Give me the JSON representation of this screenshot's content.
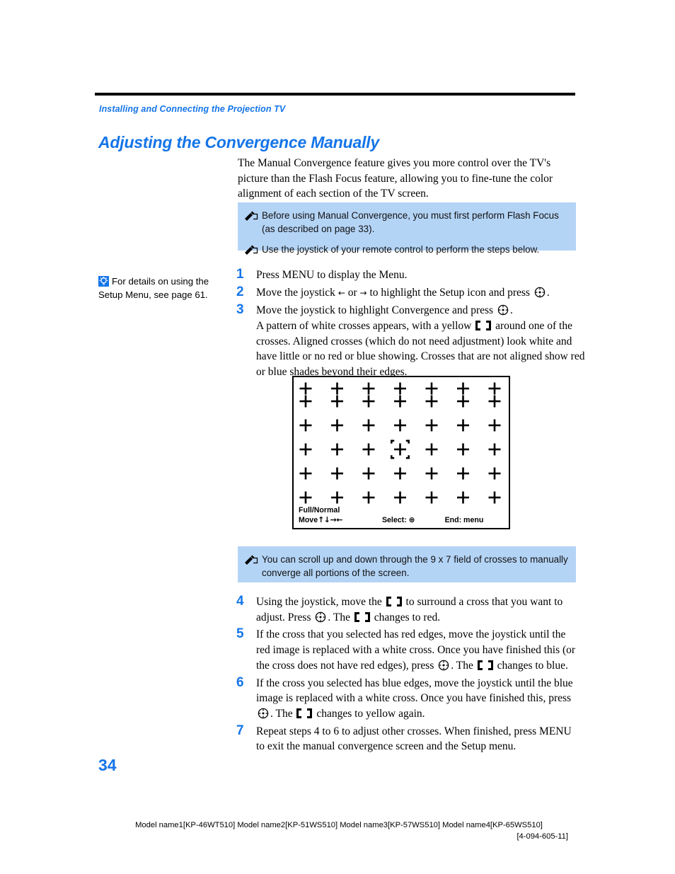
{
  "header": {
    "running_head": "Installing and Connecting the Projection TV",
    "title": "Adjusting the Convergence Manually"
  },
  "intro": {
    "paragraph": "The Manual Convergence feature gives you more control over the TV's picture than the Flash Focus feature, allowing you to fine-tune the color alignment of each section of the TV screen."
  },
  "notebox1": {
    "icon": "pencil-note-icon",
    "notes": [
      "Before using Manual Convergence, you must first perform Flash Focus (as described on page 33).",
      "Use the joystick of your remote control to perform the steps below."
    ]
  },
  "notebox2": {
    "icon": "pencil-note-icon",
    "notes": [
      "You can scroll up and down through the 9 x 7 field of crosses to manually converge all portions of the screen."
    ]
  },
  "margin_tip": {
    "icon": "lightbulb-tip-icon",
    "text": "For details on using the Setup Menu, see page 61."
  },
  "steps_a": [
    {
      "number": "1",
      "segments": [
        {
          "type": "text",
          "value": "Press MENU to display the Menu."
        }
      ]
    },
    {
      "number": "2",
      "segments": [
        {
          "type": "text",
          "value": "Move the joystick "
        },
        {
          "type": "glyph",
          "value": "←"
        },
        {
          "type": "text",
          "value": " or "
        },
        {
          "type": "glyph",
          "value": "→"
        },
        {
          "type": "text",
          "value": " to highlight the Setup icon and press "
        },
        {
          "type": "icon",
          "value": "joystick-button-icon"
        },
        {
          "type": "text",
          "value": "."
        }
      ]
    },
    {
      "number": "3",
      "segments": [
        {
          "type": "text",
          "value": "Move the joystick to highlight Convergence and press "
        },
        {
          "type": "icon",
          "value": "joystick-button-icon"
        },
        {
          "type": "text",
          "value": "."
        }
      ]
    }
  ],
  "step3_detail": [
    {
      "type": "text",
      "value": "A pattern of white crosses appears, with a yellow "
    },
    {
      "type": "icon",
      "value": "bracket-cursor-icon"
    },
    {
      "type": "text",
      "value": " around one of the crosses. Aligned crosses (which do not need adjustment) look white and have little or no red or blue showing. Crosses that are not aligned show red or blue shades beyond their edges."
    }
  ],
  "steps_b": [
    {
      "number": "4",
      "segments": [
        {
          "type": "text",
          "value": "Using the joystick, move the "
        },
        {
          "type": "icon",
          "value": "bracket-cursor-icon"
        },
        {
          "type": "text",
          "value": " to surround a cross that you want to adjust. Press "
        },
        {
          "type": "icon",
          "value": "joystick-button-icon"
        },
        {
          "type": "text",
          "value": ". The "
        },
        {
          "type": "icon",
          "value": "bracket-cursor-icon"
        },
        {
          "type": "text",
          "value": " changes to red."
        }
      ]
    },
    {
      "number": "5",
      "segments": [
        {
          "type": "text",
          "value": "If the cross that you selected has red edges, move the joystick until the red image is replaced with a white cross. Once you have finished this (or the cross does not have red edges), press "
        },
        {
          "type": "icon",
          "value": "joystick-button-icon"
        },
        {
          "type": "text",
          "value": ". The "
        },
        {
          "type": "icon",
          "value": "bracket-cursor-icon"
        },
        {
          "type": "text",
          "value": " changes to blue."
        }
      ]
    },
    {
      "number": "6",
      "segments": [
        {
          "type": "text",
          "value": "If the cross you selected has blue edges, move the joystick until the blue image is replaced with a white cross. Once you have finished this, press "
        },
        {
          "type": "icon",
          "value": "joystick-button-icon"
        },
        {
          "type": "text",
          "value": ". The "
        },
        {
          "type": "icon",
          "value": "bracket-cursor-icon"
        },
        {
          "type": "text",
          "value": " changes to yellow again."
        }
      ]
    },
    {
      "number": "7",
      "segments": [
        {
          "type": "text",
          "value": "Repeat steps 4 to 6 to adjust other crosses. When finished, press MENU to exit the manual convergence screen and the Setup menu."
        }
      ]
    }
  ],
  "convergence_screen": {
    "columns": 7,
    "rows": 7,
    "selected_cross": {
      "row": 4,
      "column": 4
    },
    "selection_marker": "bracket-cursor-icon",
    "footer": {
      "mode_label": "Full/Normal",
      "move_label": "Move",
      "move_arrows": "↑↓→←",
      "select_label": "Select:",
      "select_glyph": "⊕",
      "end_label": "End: menu"
    }
  },
  "folio": {
    "page_number": "34"
  },
  "footer": {
    "models": "Model name1[KP-46WT510] Model name2[KP-51WS510] Model name3[KP-57WS510] Model name4[KP-65WS510]",
    "doc_number": "[4-094-605-11]"
  },
  "colors": {
    "accent_blue": "#1575e8",
    "note_background": "#b4d4f6",
    "text_black": "#000000"
  }
}
